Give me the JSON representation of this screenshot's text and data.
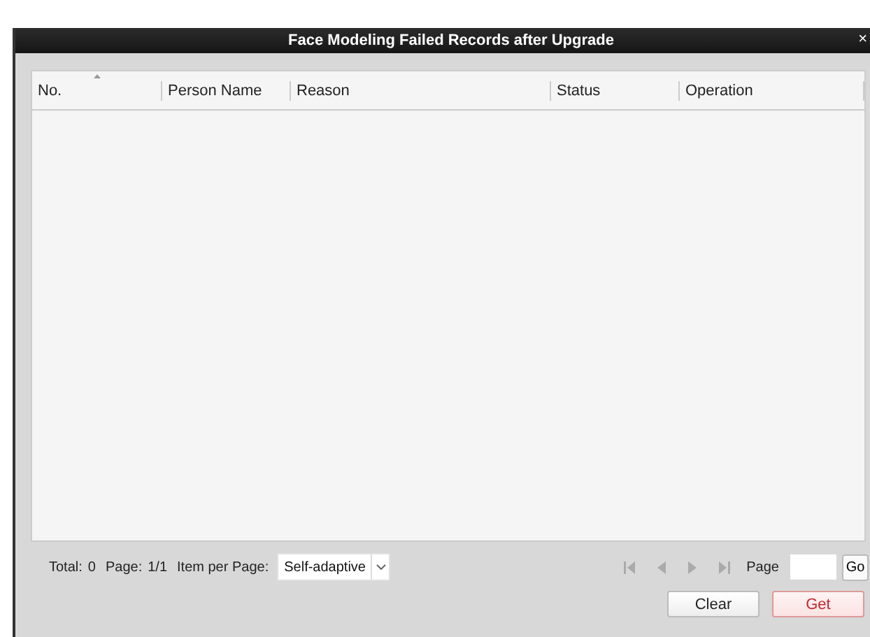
{
  "window": {
    "title": "Face Modeling Failed Records after Upgrade",
    "close": "×"
  },
  "table": {
    "columns": [
      {
        "label": "No.",
        "sorted": true
      },
      {
        "label": "Person Name",
        "sorted": false
      },
      {
        "label": "Reason",
        "sorted": false
      },
      {
        "label": "Status",
        "sorted": false
      },
      {
        "label": "Operation",
        "sorted": false
      }
    ]
  },
  "pagination": {
    "total_label": "Total:",
    "total": "0",
    "page_label": "Page:",
    "page": "1/1",
    "per_page_label": "Item per Page:",
    "per_page": "Self-adaptive",
    "goto_label": "Page",
    "go": "Go"
  },
  "buttons": [
    {
      "label": "Clear",
      "kind": "normal"
    },
    {
      "label": "Get",
      "kind": "primary"
    }
  ]
}
